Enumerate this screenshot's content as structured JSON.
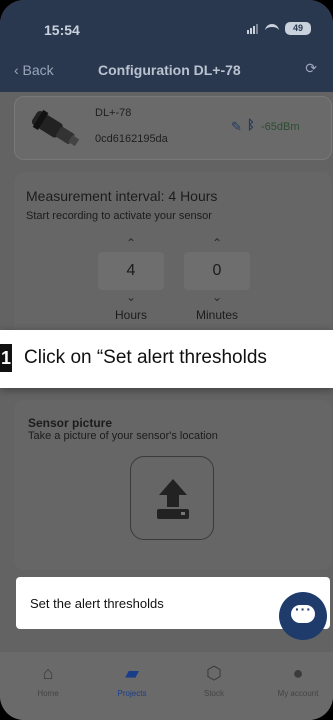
{
  "status_bar": {
    "time": "15:54",
    "battery": "49"
  },
  "nav": {
    "back_label": "‹ Back",
    "title": "Configuration DL+-78",
    "refresh_icon": "refresh-icon"
  },
  "sensor": {
    "name": "DL+-78",
    "id": "0cd6162195da",
    "rssi": "-65dBm"
  },
  "measurement": {
    "title": "Measurement interval: 4 Hours",
    "subtitle": "Start recording to activate your sensor",
    "hours_value": "4",
    "hours_label": "Hours",
    "minutes_value": "0",
    "minutes_label": "Minutes"
  },
  "banner": {
    "step": "1",
    "text": "Click on “Set alert thresholds"
  },
  "picture": {
    "title": "Sensor picture",
    "subtitle": "Take a picture of your sensor's location"
  },
  "alert_button": {
    "label": "Set the alert thresholds"
  },
  "tabs": [
    {
      "label": "Home",
      "icon": "home-icon"
    },
    {
      "label": "Projects",
      "icon": "briefcase-icon"
    },
    {
      "label": "Stock",
      "icon": "box-icon"
    },
    {
      "label": "My account",
      "icon": "user-icon"
    }
  ],
  "colors": {
    "header": "#29374f",
    "accent": "#1a3d8a",
    "chat": "#1e3b6c"
  }
}
